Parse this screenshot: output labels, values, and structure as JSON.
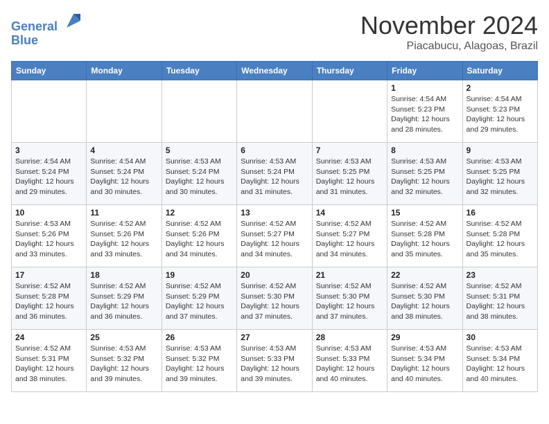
{
  "header": {
    "logo_line1": "General",
    "logo_line2": "Blue",
    "month": "November 2024",
    "location": "Piacabucu, Alagoas, Brazil"
  },
  "weekdays": [
    "Sunday",
    "Monday",
    "Tuesday",
    "Wednesday",
    "Thursday",
    "Friday",
    "Saturday"
  ],
  "weeks": [
    [
      {
        "day": "",
        "sunrise": "",
        "sunset": "",
        "daylight": ""
      },
      {
        "day": "",
        "sunrise": "",
        "sunset": "",
        "daylight": ""
      },
      {
        "day": "",
        "sunrise": "",
        "sunset": "",
        "daylight": ""
      },
      {
        "day": "",
        "sunrise": "",
        "sunset": "",
        "daylight": ""
      },
      {
        "day": "",
        "sunrise": "",
        "sunset": "",
        "daylight": ""
      },
      {
        "day": "1",
        "sunrise": "4:54 AM",
        "sunset": "5:23 PM",
        "daylight": "12 hours and 28 minutes."
      },
      {
        "day": "2",
        "sunrise": "4:54 AM",
        "sunset": "5:23 PM",
        "daylight": "12 hours and 29 minutes."
      }
    ],
    [
      {
        "day": "3",
        "sunrise": "4:54 AM",
        "sunset": "5:24 PM",
        "daylight": "12 hours and 29 minutes."
      },
      {
        "day": "4",
        "sunrise": "4:54 AM",
        "sunset": "5:24 PM",
        "daylight": "12 hours and 30 minutes."
      },
      {
        "day": "5",
        "sunrise": "4:53 AM",
        "sunset": "5:24 PM",
        "daylight": "12 hours and 30 minutes."
      },
      {
        "day": "6",
        "sunrise": "4:53 AM",
        "sunset": "5:24 PM",
        "daylight": "12 hours and 31 minutes."
      },
      {
        "day": "7",
        "sunrise": "4:53 AM",
        "sunset": "5:25 PM",
        "daylight": "12 hours and 31 minutes."
      },
      {
        "day": "8",
        "sunrise": "4:53 AM",
        "sunset": "5:25 PM",
        "daylight": "12 hours and 32 minutes."
      },
      {
        "day": "9",
        "sunrise": "4:53 AM",
        "sunset": "5:25 PM",
        "daylight": "12 hours and 32 minutes."
      }
    ],
    [
      {
        "day": "10",
        "sunrise": "4:53 AM",
        "sunset": "5:26 PM",
        "daylight": "12 hours and 33 minutes."
      },
      {
        "day": "11",
        "sunrise": "4:52 AM",
        "sunset": "5:26 PM",
        "daylight": "12 hours and 33 minutes."
      },
      {
        "day": "12",
        "sunrise": "4:52 AM",
        "sunset": "5:26 PM",
        "daylight": "12 hours and 34 minutes."
      },
      {
        "day": "13",
        "sunrise": "4:52 AM",
        "sunset": "5:27 PM",
        "daylight": "12 hours and 34 minutes."
      },
      {
        "day": "14",
        "sunrise": "4:52 AM",
        "sunset": "5:27 PM",
        "daylight": "12 hours and 34 minutes."
      },
      {
        "day": "15",
        "sunrise": "4:52 AM",
        "sunset": "5:28 PM",
        "daylight": "12 hours and 35 minutes."
      },
      {
        "day": "16",
        "sunrise": "4:52 AM",
        "sunset": "5:28 PM",
        "daylight": "12 hours and 35 minutes."
      }
    ],
    [
      {
        "day": "17",
        "sunrise": "4:52 AM",
        "sunset": "5:28 PM",
        "daylight": "12 hours and 36 minutes."
      },
      {
        "day": "18",
        "sunrise": "4:52 AM",
        "sunset": "5:29 PM",
        "daylight": "12 hours and 36 minutes."
      },
      {
        "day": "19",
        "sunrise": "4:52 AM",
        "sunset": "5:29 PM",
        "daylight": "12 hours and 37 minutes."
      },
      {
        "day": "20",
        "sunrise": "4:52 AM",
        "sunset": "5:30 PM",
        "daylight": "12 hours and 37 minutes."
      },
      {
        "day": "21",
        "sunrise": "4:52 AM",
        "sunset": "5:30 PM",
        "daylight": "12 hours and 37 minutes."
      },
      {
        "day": "22",
        "sunrise": "4:52 AM",
        "sunset": "5:30 PM",
        "daylight": "12 hours and 38 minutes."
      },
      {
        "day": "23",
        "sunrise": "4:52 AM",
        "sunset": "5:31 PM",
        "daylight": "12 hours and 38 minutes."
      }
    ],
    [
      {
        "day": "24",
        "sunrise": "4:52 AM",
        "sunset": "5:31 PM",
        "daylight": "12 hours and 38 minutes."
      },
      {
        "day": "25",
        "sunrise": "4:53 AM",
        "sunset": "5:32 PM",
        "daylight": "12 hours and 39 minutes."
      },
      {
        "day": "26",
        "sunrise": "4:53 AM",
        "sunset": "5:32 PM",
        "daylight": "12 hours and 39 minutes."
      },
      {
        "day": "27",
        "sunrise": "4:53 AM",
        "sunset": "5:33 PM",
        "daylight": "12 hours and 39 minutes."
      },
      {
        "day": "28",
        "sunrise": "4:53 AM",
        "sunset": "5:33 PM",
        "daylight": "12 hours and 40 minutes."
      },
      {
        "day": "29",
        "sunrise": "4:53 AM",
        "sunset": "5:34 PM",
        "daylight": "12 hours and 40 minutes."
      },
      {
        "day": "30",
        "sunrise": "4:53 AM",
        "sunset": "5:34 PM",
        "daylight": "12 hours and 40 minutes."
      }
    ]
  ]
}
